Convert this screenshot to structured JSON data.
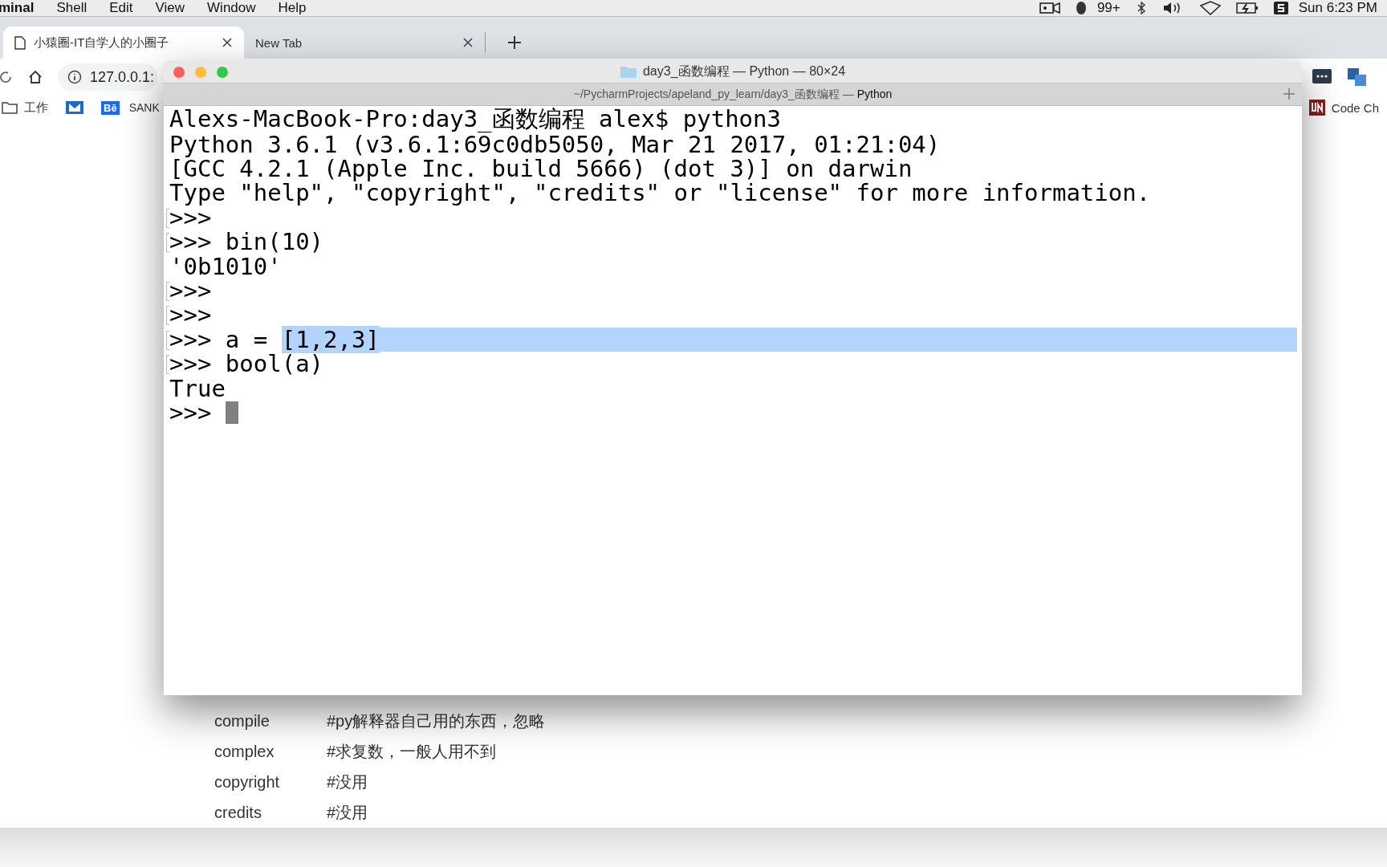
{
  "menu_bar": {
    "app": "minal",
    "items": [
      "Shell",
      "Edit",
      "View",
      "Window",
      "Help"
    ],
    "notification_count": "99+",
    "clock": "Sun 6:23 PM"
  },
  "browser": {
    "tabs": [
      {
        "title": "小猿圈-IT自学人的小圈子",
        "selected": true
      },
      {
        "title": "New Tab",
        "selected": false
      }
    ],
    "address": "127.0.0.1:",
    "bookmarks": [
      {
        "kind": "folder",
        "label": "工作"
      },
      {
        "kind": "icon"
      },
      {
        "kind": "badge",
        "label": "Bē"
      },
      {
        "kind": "text",
        "label": "SANK"
      }
    ],
    "right_bookmark": "Code Ch",
    "page_items": [
      {
        "name": "compile",
        "comment": "#py解释器自己用的东西，忽略"
      },
      {
        "name": "complex",
        "comment": "#求复数，一般人用不到"
      },
      {
        "name": "copyright",
        "comment": "#没用"
      },
      {
        "name": "credits",
        "comment": "#没用"
      }
    ]
  },
  "terminal": {
    "title": "day3_函数编程 — Python — 80×24",
    "tab_path": "~/PycharmProjects/apeland_py_learn/day3_函数编程 — ",
    "tab_process": "Python",
    "lines": [
      {
        "text": "Alexs-MacBook-Pro:day3_函数编程 alex$ python3",
        "marked": false
      },
      {
        "text": "Python 3.6.1 (v3.6.1:69c0db5050, Mar 21 2017, 01:21:04)",
        "marked": false
      },
      {
        "text": "[GCC 4.2.1 (Apple Inc. build 5666) (dot 3)] on darwin",
        "marked": false
      },
      {
        "text": "Type \"help\", \"copyright\", \"credits\" or \"license\" for more information.",
        "marked": false
      },
      {
        "text": ">>>",
        "marked": true
      },
      {
        "text": ">>> bin(10)",
        "marked": true
      },
      {
        "text": "'0b1010'",
        "marked": false
      },
      {
        "text": ">>>",
        "marked": true
      },
      {
        "text": ">>>",
        "marked": true
      },
      {
        "text": ">>> a = ",
        "selection": "[1,2,3]",
        "marked": true
      },
      {
        "text": ">>> bool(a)",
        "marked": true
      },
      {
        "text": "True",
        "marked": false
      },
      {
        "text": ">>> ",
        "cursor": true,
        "marked": false
      }
    ]
  }
}
